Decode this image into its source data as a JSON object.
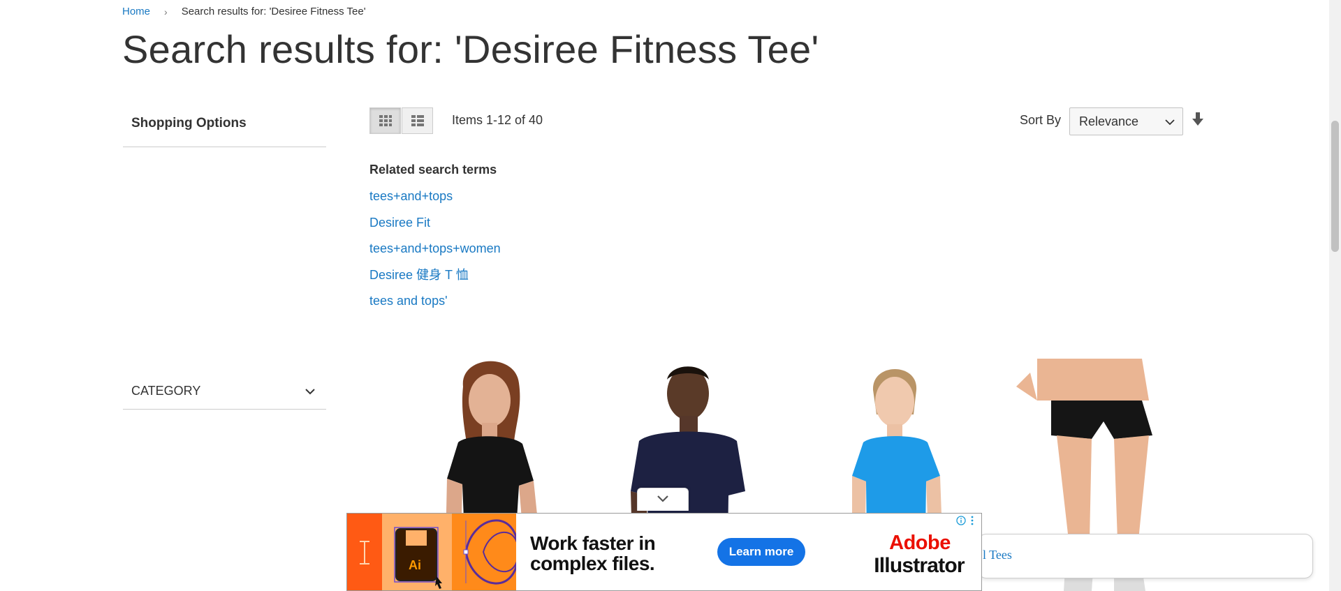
{
  "breadcrumb": {
    "home": "Home",
    "separator": "›",
    "current": "Search results for: 'Desiree Fitness Tee'"
  },
  "page": {
    "title": "Search results for: 'Desiree Fitness Tee'"
  },
  "sidebar": {
    "shopping_options": "Shopping Options",
    "category_label": "CATEGORY",
    "category_icon": "chevron-down-icon"
  },
  "toolbar": {
    "grid_icon": "grid-icon",
    "list_icon": "list-icon",
    "items_count": "Items 1-12 of 40",
    "sort_label": "Sort By",
    "sort_value": "Relevance",
    "sort_direction_icon": "arrow-down-icon"
  },
  "related": {
    "title": "Related search terms",
    "terms": [
      "tees+and+tops",
      "Desiree Fit",
      "tees+and+tops+women",
      "Desiree 健身 T 恤",
      "tees and tops'"
    ]
  },
  "products": [
    {
      "image": "woman-black-fitted-tee"
    },
    {
      "image": "man-navy-tee"
    },
    {
      "image": "woman-blue-tee"
    },
    {
      "image": "woman-black-shorts"
    }
  ],
  "ad": {
    "headline_line1": "Work faster in",
    "headline_line2": "complex files.",
    "cta": "Learn more",
    "brand_line1": "Adobe",
    "brand_line2": "Illustrator",
    "app_badge": "Ai",
    "collapse_icon": "chevron-down-icon",
    "info_icon": "info-icon",
    "menu_icon": "kebab-menu-icon"
  },
  "chat_bubble": {
    "text": "l Tees"
  },
  "colors": {
    "link": "#1979c3",
    "ad_orange": "#ff5a14",
    "ad_button": "#1473e6",
    "adobe_red": "#eb1000"
  }
}
